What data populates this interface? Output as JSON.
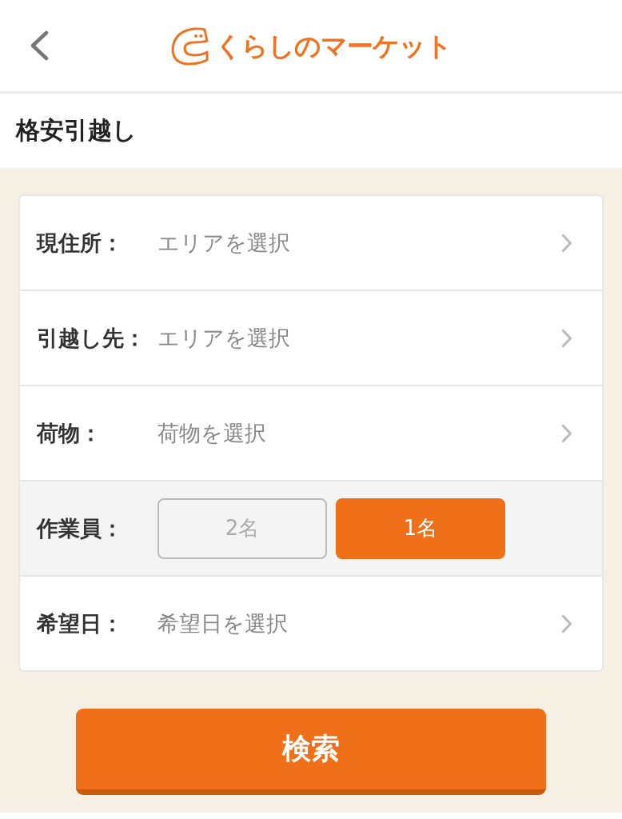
{
  "header": {
    "logo": "くらしのマーケット"
  },
  "page_title": "格安引越し",
  "form": {
    "rows": [
      {
        "kind": "select",
        "label": "現住所：",
        "placeholder": "エリアを選択"
      },
      {
        "kind": "select",
        "label": "引越し先：",
        "placeholder": "エリアを選択"
      },
      {
        "kind": "select",
        "label": "荷物：",
        "placeholder": "荷物を選択"
      },
      {
        "kind": "choice",
        "label": "作業員：",
        "options": [
          {
            "label": "2名",
            "selected": false
          },
          {
            "label": "1名",
            "selected": true
          }
        ]
      },
      {
        "kind": "select",
        "label": "希望日：",
        "placeholder": "希望日を選択"
      }
    ]
  },
  "search_button": "検索"
}
